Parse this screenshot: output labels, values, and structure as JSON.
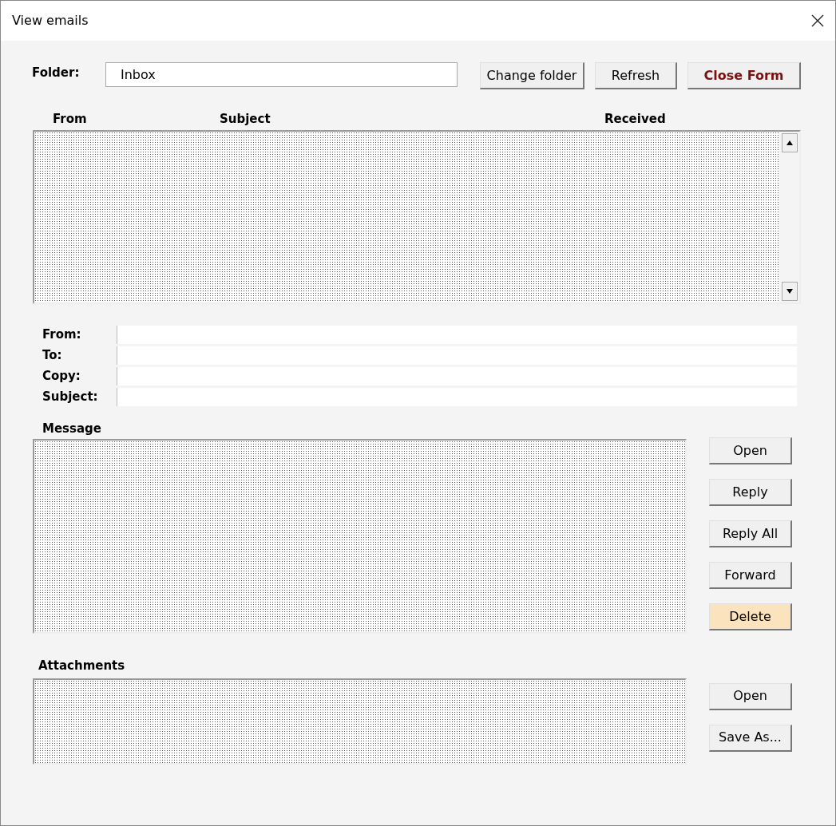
{
  "window": {
    "title": "View emails"
  },
  "folder": {
    "label": "Folder:",
    "value": "Inbox"
  },
  "toolbar_buttons": [
    {
      "label": "Change folder",
      "kind": "normal"
    },
    {
      "label": "Refresh",
      "kind": "normal"
    },
    {
      "label": "Close Form",
      "kind": "danger"
    }
  ],
  "email_list": {
    "columns": [
      "From",
      "Subject",
      "Received"
    ]
  },
  "details": [
    {
      "label": "From:"
    },
    {
      "label": "To:"
    },
    {
      "label": "Copy:"
    },
    {
      "label": "Subject:"
    }
  ],
  "message": {
    "label": "Message",
    "buttons": [
      {
        "label": "Open",
        "kind": "normal"
      },
      {
        "label": "Reply",
        "kind": "normal"
      },
      {
        "label": "Reply All",
        "kind": "normal"
      },
      {
        "label": "Forward",
        "kind": "normal"
      },
      {
        "label": "Delete",
        "kind": "highlight"
      }
    ]
  },
  "attachments": {
    "label": "Attachments",
    "buttons": [
      {
        "label": "Open"
      },
      {
        "label": "Save As..."
      }
    ]
  }
}
